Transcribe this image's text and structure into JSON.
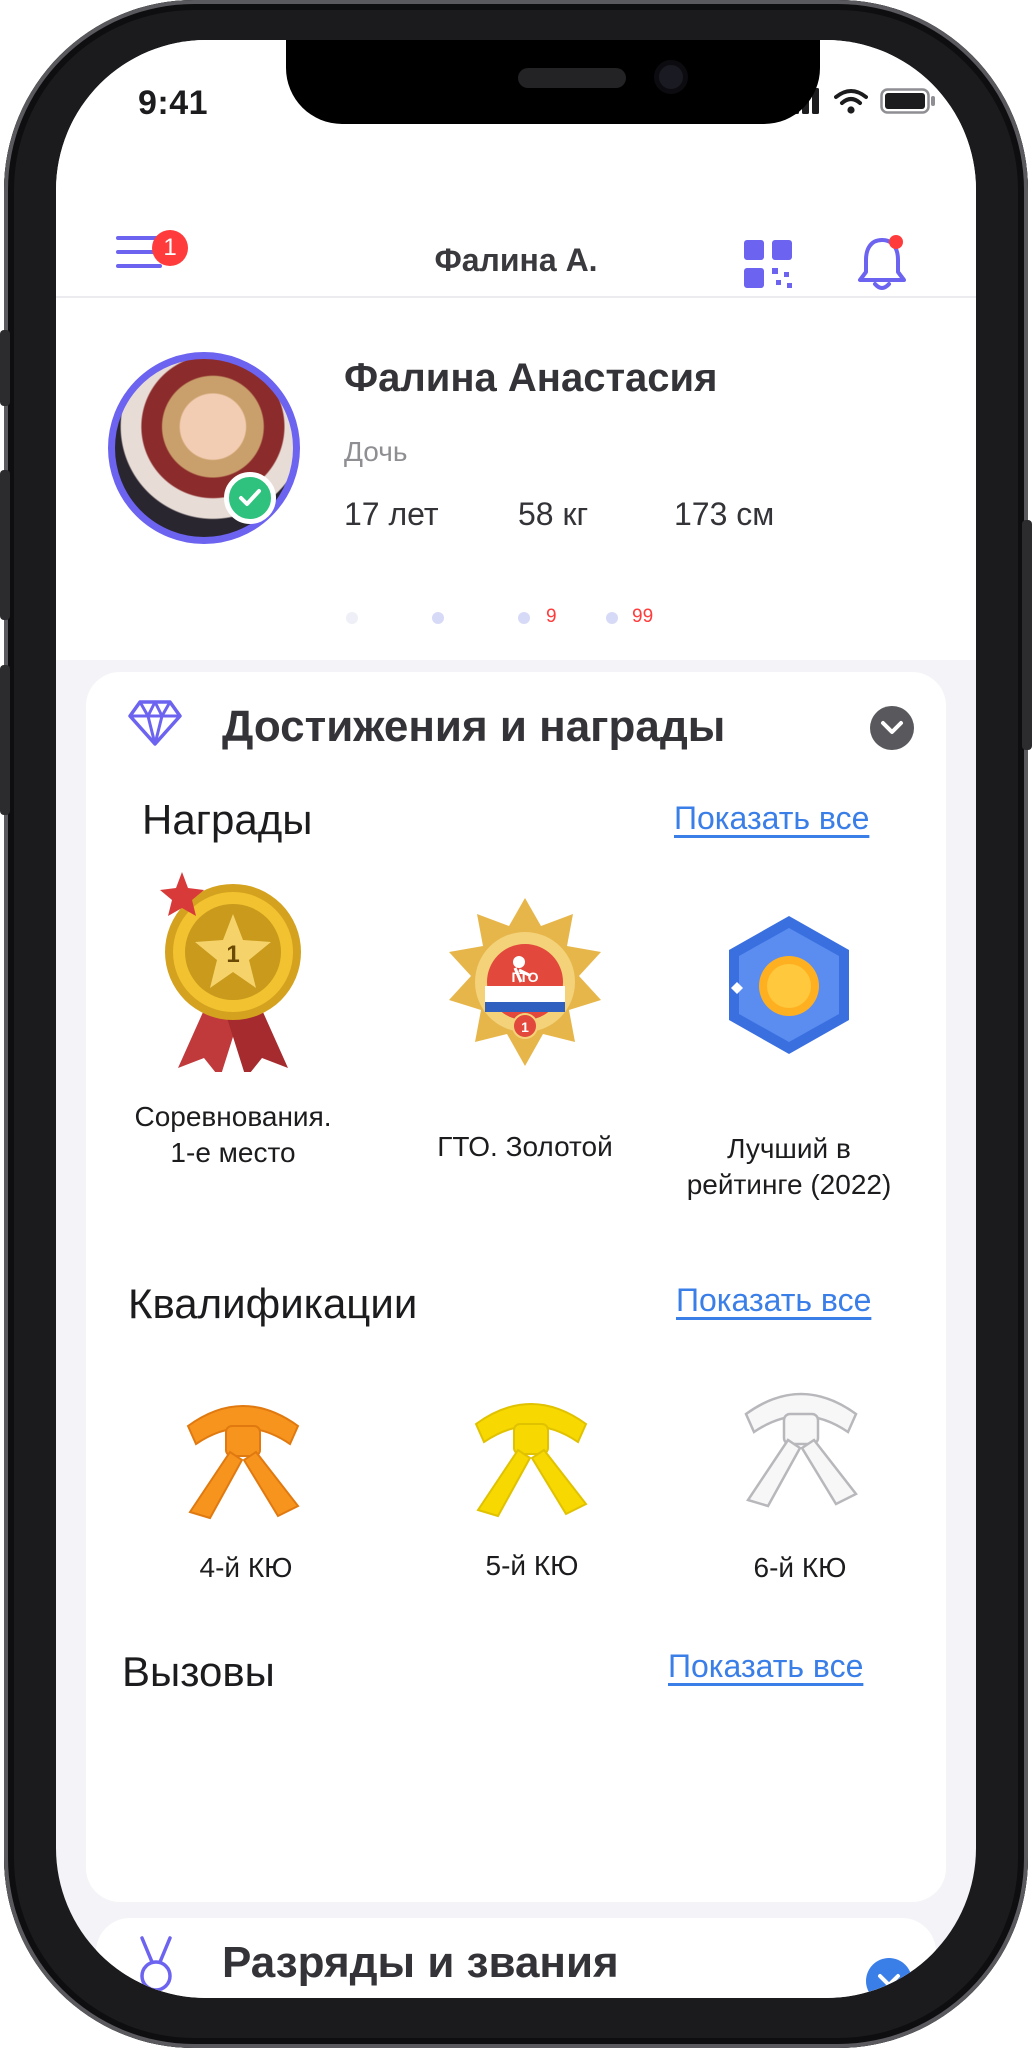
{
  "status_bar": {
    "time": "9:41"
  },
  "header": {
    "title": "Фалина А.",
    "menu_badge": "1"
  },
  "profile": {
    "name": "Фалина Анастасия",
    "role": "Дочь",
    "age": "17 лет",
    "weight": "58 кг",
    "height": "173 см",
    "verified": true
  },
  "pager": {
    "counts": [
      "9",
      "99"
    ]
  },
  "achievements": {
    "title": "Достижения и награды",
    "awards": {
      "title": "Награды",
      "show_all": "Показать все",
      "items": [
        {
          "label": "Соревнования.\n1-е место",
          "icon": "gold-medal-icon"
        },
        {
          "label": "ГТО. Золотой",
          "icon": "gto-badge-icon",
          "badge_text": "ГТО",
          "badge_number": "1"
        },
        {
          "label": "Лучший в\nрейтинге (2022)",
          "icon": "rating-badge-icon"
        }
      ],
      "medal_number": "1"
    },
    "qualifications": {
      "title": "Квалификации",
      "show_all": "Показать все",
      "items": [
        {
          "label": "4-й КЮ",
          "color": "#f7941d"
        },
        {
          "label": "5-й КЮ",
          "color": "#f7d800"
        },
        {
          "label": "6-й КЮ",
          "color": "#f5f5f5"
        }
      ]
    },
    "challenges": {
      "title": "Вызовы",
      "show_all": "Показать все"
    }
  },
  "ranks": {
    "title": "Разряды и звания"
  },
  "colors": {
    "accent": "#6c63f0",
    "link": "#3a7ee8",
    "badge": "#ff3b3b",
    "verified": "#2ec27e"
  }
}
